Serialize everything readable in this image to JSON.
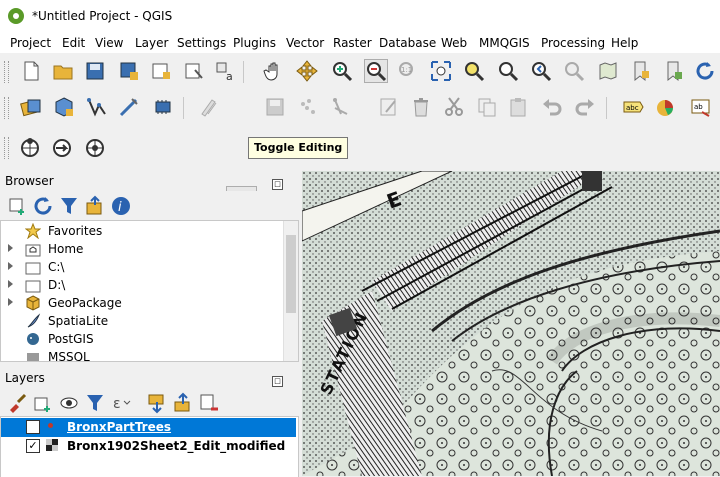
{
  "window": {
    "title": "*Untitled Project - QGIS"
  },
  "menu": [
    "Project",
    "Edit",
    "View",
    "Layer",
    "Settings",
    "Plugins",
    "Vector",
    "Raster",
    "Database",
    "Web",
    "MMQGIS",
    "Processing",
    "Help"
  ],
  "tooltip": "Toggle Editing",
  "browser": {
    "title": "Browser",
    "items": [
      {
        "label": "Favorites",
        "icon": "star-icon"
      },
      {
        "label": "Home",
        "icon": "home-folder-icon"
      },
      {
        "label": "C:\\",
        "icon": "drive-icon"
      },
      {
        "label": "D:\\",
        "icon": "drive-icon"
      },
      {
        "label": "GeoPackage",
        "icon": "geopackage-icon"
      },
      {
        "label": "SpatiaLite",
        "icon": "spatialite-icon"
      },
      {
        "label": "PostGIS",
        "icon": "postgis-icon"
      },
      {
        "label": "MSSQL",
        "icon": "mssql-icon"
      }
    ]
  },
  "layers": {
    "title": "Layers",
    "items": [
      {
        "label": "BronxPartTrees",
        "checked": true,
        "selected": true,
        "icon": "point-layer-icon"
      },
      {
        "label": "Bronx1902Sheet2_Edit_modified",
        "checked": true,
        "selected": false,
        "icon": "raster-layer-icon"
      }
    ]
  },
  "map": {
    "labels": [
      "STATION",
      "E"
    ]
  },
  "colors": {
    "selection": "#0078d7",
    "accent_green": "#5a9a28"
  }
}
